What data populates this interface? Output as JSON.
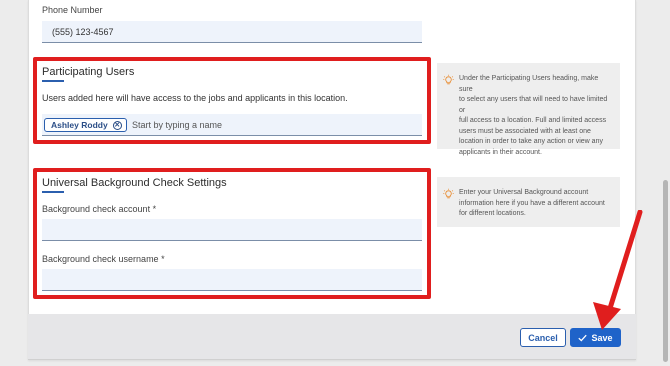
{
  "phone": {
    "label": "Phone Number",
    "value": "(555) 123-4567"
  },
  "participating_users": {
    "title": "Participating Users",
    "description": "Users added here will have access to the jobs and applicants in this location.",
    "chips": [
      {
        "label": "Ashley Roddy"
      }
    ],
    "input_placeholder": "Start by typing a name",
    "tip_lines": [
      "Under the Participating Users heading, make sure",
      "to select any users that will need to have limited or",
      "full access to a location. Full and limited access",
      "users must be associated with at least one",
      "location in order to take any action or view any",
      "applicants in their account."
    ]
  },
  "background_check": {
    "title": "Universal Background Check Settings",
    "account_label": "Background check account *",
    "account_value": "",
    "username_label": "Background check username *",
    "username_value": "",
    "tip_lines": [
      "Enter your Universal Background account",
      "information here if you have a different account",
      "for different locations."
    ]
  },
  "footer": {
    "cancel_label": "Cancel",
    "save_label": "Save"
  },
  "icons": {
    "tip": "lightbulb-icon",
    "chip_remove": "close-circle-icon",
    "save": "checkmark-icon"
  },
  "colors": {
    "highlight": "#e01e1e",
    "primary": "#1f63c9",
    "field_bg": "#eef3fb"
  }
}
